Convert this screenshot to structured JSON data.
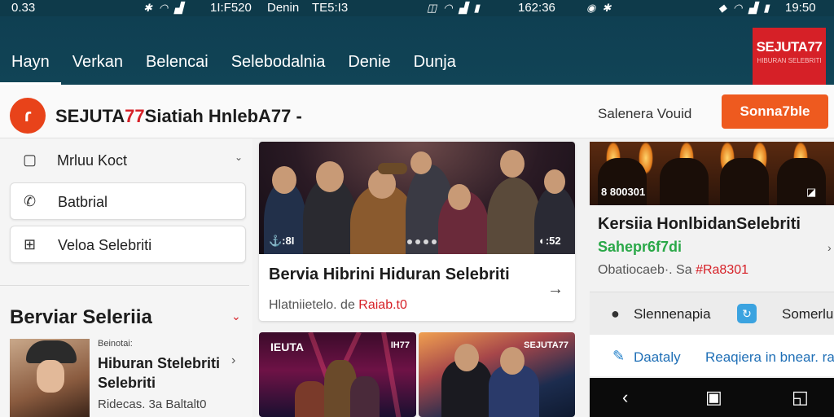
{
  "status_bar": {
    "time_left": "0.33",
    "center_text_1": "1I:F520",
    "center_text_2": "Denin",
    "center_text_3": "TE5:I3",
    "center_time": "162:36",
    "right_time": "19:50"
  },
  "nav": {
    "tabs": [
      {
        "label": "Hayn"
      },
      {
        "label": "Verkan"
      },
      {
        "label": "Belencai"
      },
      {
        "label": "Selebodalnia"
      },
      {
        "label": "Denie"
      },
      {
        "label": "Dunja"
      }
    ],
    "brand": {
      "name": "SEJUTA77",
      "tagline": "HIBURAN SELEBRITI"
    }
  },
  "topbar": {
    "logo_glyph": "ɾ",
    "title_prefix": "SEJUTA",
    "title_red": "77",
    "title_rest": "Siatiah HnlebA77 -",
    "link": "Salenera Vouid",
    "cta": "Sonna7ble"
  },
  "sidebar": {
    "items": [
      {
        "label": "Mrluu Koct",
        "icon": "clipboard-icon"
      },
      {
        "label": "Batbrial",
        "icon": "phone-icon"
      },
      {
        "label": "Veloa Selebriti",
        "icon": "grid-icon"
      }
    ],
    "section_title": "Berviar Seleriia",
    "mini_card": {
      "kicker": "Beinotai:",
      "title": "Hiburan Stelebriti Selebriti",
      "meta": "Ridecas. 3a Baltalt0"
    }
  },
  "main_card": {
    "badge_left": "⚓:8I",
    "badge_right": "◐:52",
    "title": "Bervia Hibrini Hiduran Selebriti",
    "meta_prefix": "Hlatniietelo. de ",
    "meta_red": "Raiab.t0"
  },
  "bottom_cards": [
    {
      "label": "IEUTA",
      "label_right": "IH77"
    },
    {
      "label": "",
      "label_right": "SEJUTA77"
    }
  ],
  "right_card": {
    "badge_left": "8 800301",
    "badge_right": "◪",
    "title": "Kersiia HonlbidanSelebriti",
    "subtitle": "Sahepr6f7di",
    "meta_prefix": "Obatiocaeb·. Sa ",
    "meta_red": "#Ra8301"
  },
  "right_panel": {
    "row1_left": "Slennenapia",
    "row1_right": "Somerlu",
    "row2_left": "Daataly",
    "row2_right": "Reaqiera in bnear. ra"
  },
  "colors": {
    "header": "#0f3f52",
    "brand_red": "#d62027",
    "cta_orange": "#ee5a1f",
    "green": "#2aa848",
    "link_blue": "#1f6fb6"
  }
}
